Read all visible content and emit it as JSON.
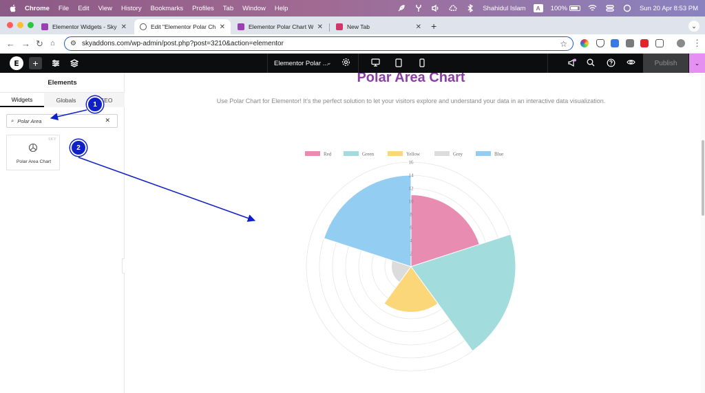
{
  "menubar": {
    "app": "Chrome",
    "items": [
      "File",
      "Edit",
      "View",
      "History",
      "Bookmarks",
      "Profiles",
      "Tab",
      "Window",
      "Help"
    ],
    "user": "Shahidul Islam",
    "input_source": "A",
    "battery": "100%",
    "datetime": "Sun 20 Apr  8:53 PM"
  },
  "tabs": [
    {
      "title": "Elementor Widgets - Sky Add",
      "favicon_color": "#9b3fb5",
      "active": false
    },
    {
      "title": "Edit \"Elementor Polar Chart W",
      "favicon_color": "#555555",
      "active": true
    },
    {
      "title": "Elementor Polar Chart Widget",
      "favicon_color": "#9b3fb5",
      "active": false
    },
    {
      "title": "New Tab",
      "favicon_color": "#d6336c",
      "active": false
    }
  ],
  "address": {
    "url": "skyaddons.com/wp-admin/post.php?post=3210&action=elementor"
  },
  "editor": {
    "document_title": "Elementor Polar ...",
    "publish_label": "Publish"
  },
  "panel": {
    "title": "Elements",
    "tabs": [
      "Widgets",
      "Globals",
      "SEO"
    ],
    "search_value": "Polar Area",
    "widget": {
      "name": "Polar Area Chart",
      "badge": "SKY"
    }
  },
  "page": {
    "heading": "Polar Area Chart",
    "subtext": "Use Polar Chart for Elementor! It's the perfect solution to let your visitors explore and understand your data in an interactive data visualization."
  },
  "chart_data": {
    "type": "polarArea",
    "categories": [
      "Red",
      "Green",
      "Yellow",
      "Grey",
      "Blue"
    ],
    "values": [
      11,
      16,
      7,
      3,
      14
    ],
    "colors": [
      "#e98cb1",
      "#a3dcdc",
      "#fbd77a",
      "#dcdcdc",
      "#94cdf2"
    ],
    "r_ticks": [
      2,
      4,
      6,
      8,
      10,
      12,
      14,
      16
    ],
    "r_max": 16,
    "legend_position": "top"
  },
  "annotations": [
    {
      "label": "1"
    },
    {
      "label": "2"
    }
  ]
}
